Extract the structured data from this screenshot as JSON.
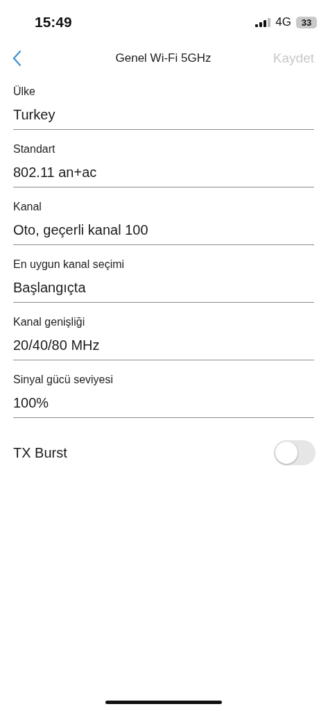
{
  "status_bar": {
    "time": "15:49",
    "network": "4G",
    "battery": "33"
  },
  "nav": {
    "title": "Genel Wi-Fi 5GHz",
    "save": {
      "label": "Kaydet",
      "disabled": true
    }
  },
  "fields": [
    {
      "label": "Ülke",
      "value": "Turkey"
    },
    {
      "label": "Standart",
      "value": "802.11 an+ac"
    },
    {
      "label": "Kanal",
      "value": "Oto, geçerli kanal 100"
    },
    {
      "label": "En uygun kanal seçimi",
      "value": "Başlangıçta"
    },
    {
      "label": "Kanal genişliği",
      "value": "20/40/80 MHz"
    },
    {
      "label": "Sinyal gücü seviyesi",
      "value": "100%"
    }
  ],
  "toggle": {
    "label": "TX Burst",
    "on": false
  }
}
